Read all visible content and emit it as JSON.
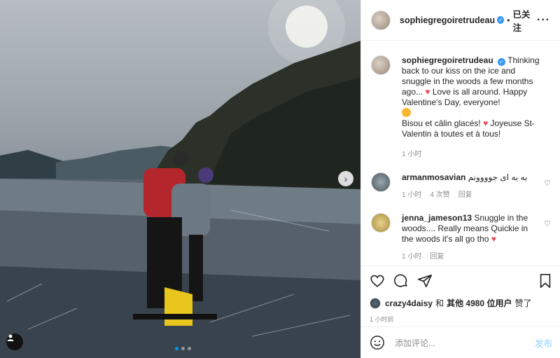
{
  "post": {
    "username": "sophiegregoiretrudeau",
    "follow_sep": "•",
    "follow_state": "已关注",
    "more_label": "···"
  },
  "caption": {
    "username": "sophiegregoiretrudeau",
    "text1": "Thinking back to our kiss on the ice and snuggle in the woods a few months ago...",
    "text1b": "Love is all around. Happy Valentine's Day, everyone!",
    "text2a": "Bisou et câlin glacés!",
    "text2b": "Joyeuse St-Valentin à toutes et à tous!",
    "time": "1 小时"
  },
  "comments": [
    {
      "username": "armanmosavian",
      "text": "به به ای جوووونم",
      "time": "1 小时",
      "likes": "4 次赞",
      "reply": "回复"
    },
    {
      "username": "jenna_jameson13",
      "text": "Snuggle in the woods.... Really means Quickie in the woods it's all go tho",
      "time": "1 小时",
      "reply": "回复"
    }
  ],
  "likes": {
    "user": "crazy4daisy",
    "conj": "和",
    "others": "其他 4980 位用户",
    "suffix": "赞了"
  },
  "timestamp": "1 小时前",
  "add_comment": {
    "placeholder": "添加评论...",
    "post_label": "发布"
  },
  "carousel": {
    "next_icon": "chevron-right-icon",
    "index": 1,
    "count": 3
  },
  "colors": {
    "accent": "#0095f6",
    "verified": "#3897f0",
    "heart": "#ed4956",
    "post_disabled": "#b2dffc"
  }
}
